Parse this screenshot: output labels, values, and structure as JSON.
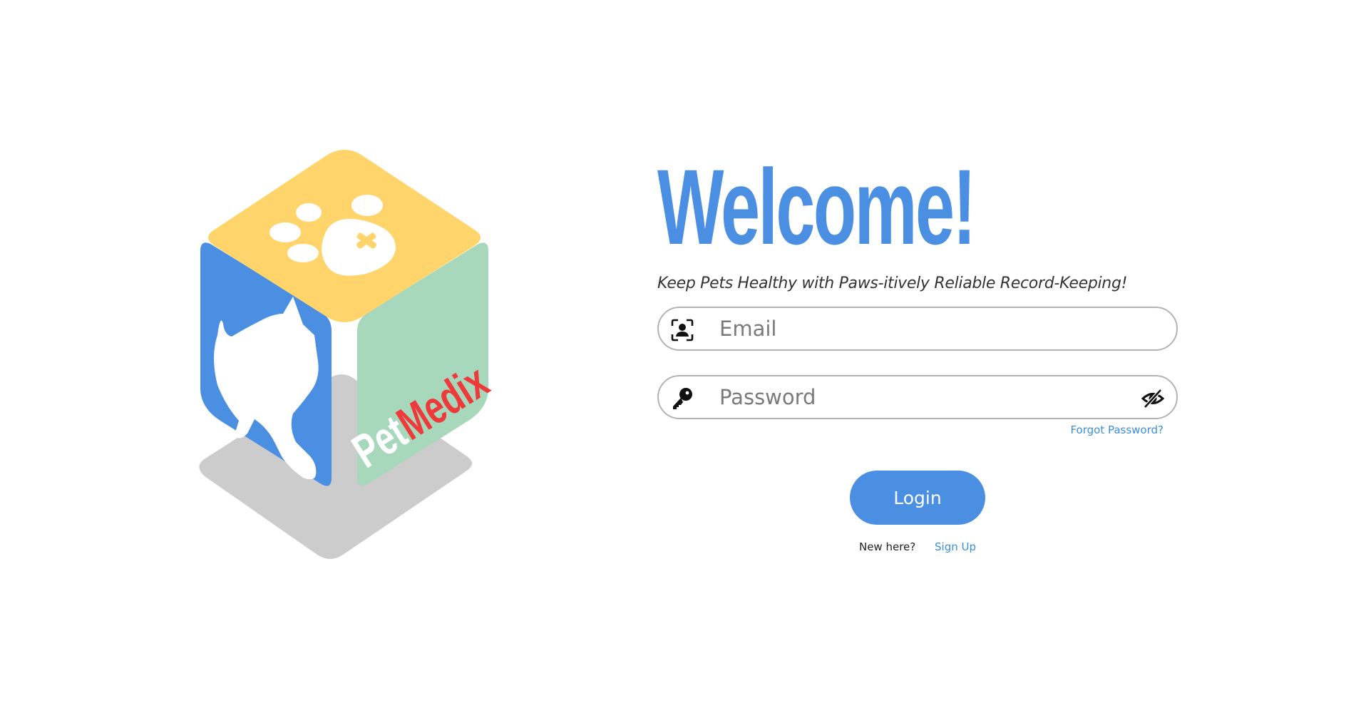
{
  "logo": {
    "brand_part1": "Pet",
    "brand_part2": "Medix",
    "colors": {
      "top": "#ffd56b",
      "left": "#4a8fe2",
      "right": "#a8d8bb",
      "shadow": "#cccccc",
      "brand_red": "#ee3a3a"
    }
  },
  "header": {
    "title": "Welcome!",
    "tagline": "Keep Pets Healthy with Paws-itively Reliable Record-Keeping!"
  },
  "form": {
    "email": {
      "placeholder": "Email",
      "value": "",
      "icon": "user-id-icon"
    },
    "password": {
      "placeholder": "Password",
      "value": "",
      "icon": "key-icon",
      "toggle_icon": "eye-slash-icon"
    },
    "forgot_label": "Forgot Password?",
    "login_label": "Login",
    "new_here_label": "New here?",
    "signup_label": "Sign Up"
  },
  "colors": {
    "accent": "#4a8fe2",
    "link": "#3a8fd8",
    "field_border": "#b3b3b3"
  }
}
